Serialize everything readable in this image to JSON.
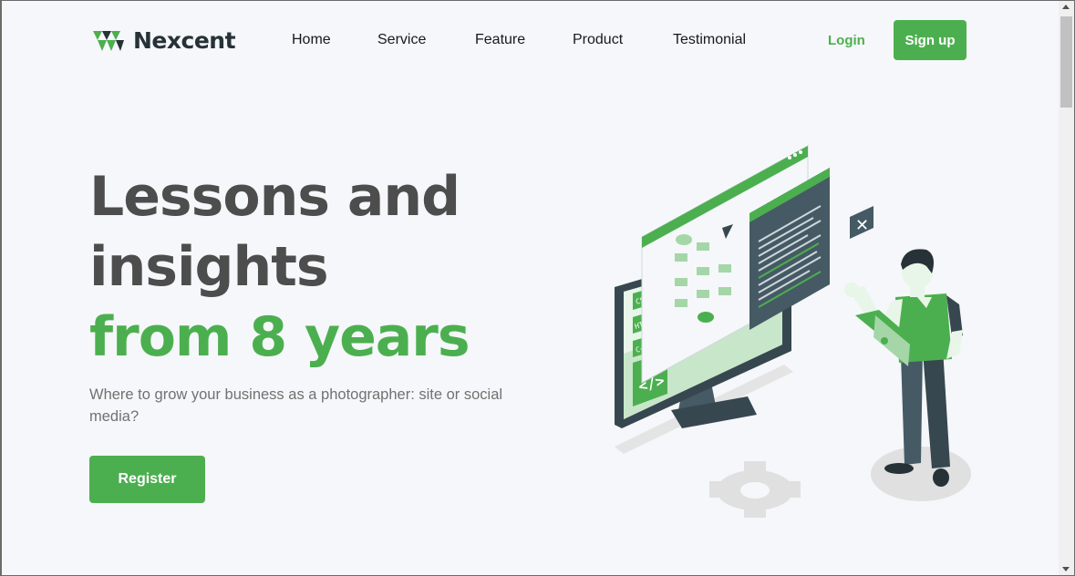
{
  "brand": {
    "name": "Nexcent",
    "accent_color": "#4caf4f",
    "text_color": "#263238"
  },
  "nav": {
    "items": [
      {
        "label": "Home"
      },
      {
        "label": "Service"
      },
      {
        "label": "Feature"
      },
      {
        "label": "Product"
      },
      {
        "label": "Testimonial"
      }
    ],
    "login_label": "Login",
    "signup_label": "Sign up"
  },
  "hero": {
    "headline_line1": "Lessons and",
    "headline_line2": "insights",
    "headline_highlight": "from 8 years",
    "subtitle": "Where to grow your business as a photographer: site or social media?",
    "cta_label": "Register",
    "illustration": {
      "icon": "developer-at-computer-illustration",
      "code_tags": [
        "CSS",
        "HTML",
        "C++"
      ]
    }
  }
}
